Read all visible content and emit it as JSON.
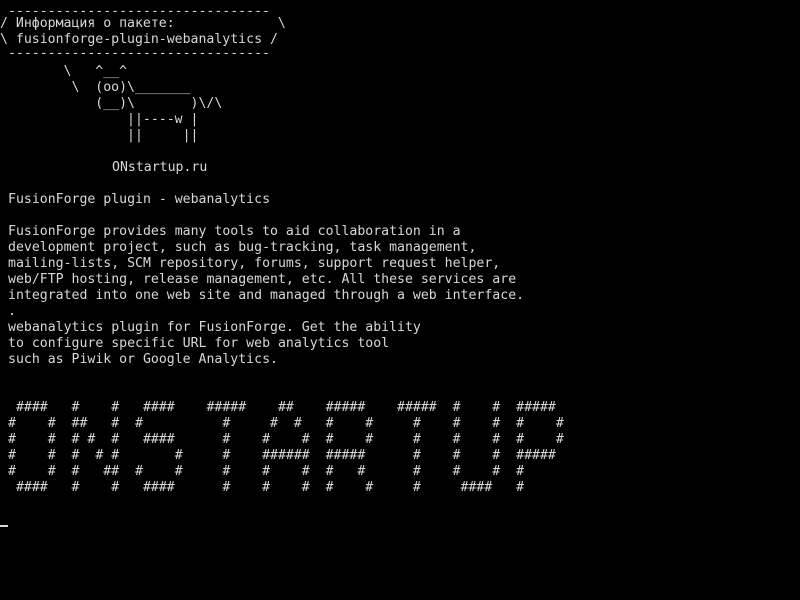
{
  "screen": {
    "background": "#000000",
    "foreground": "#d8d8d8"
  },
  "cowsay": {
    "top_border": " ---------------------------------",
    "title_line": "/ Информация о пакете:             \\",
    "package_line": "\\ fusionforge-plugin-webanalytics /",
    "bottom_border": " ---------------------------------",
    "cow": [
      "        \\   ^__^",
      "         \\  (oo)\\_______",
      "            (__)\\       )\\/\\",
      "                ||----w |",
      "                ||     ||"
    ]
  },
  "site": "ONstartup.ru",
  "package_title": "FusionForge plugin - webanalytics",
  "description": [
    "FusionForge provides many tools to aid collaboration in a",
    "development project, such as bug-tracking, task management,",
    "mailing-lists, SCM repository, forums, support request helper,",
    "web/FTP hosting, release management, etc. All these services are",
    "integrated into one web site and managed through a web interface.",
    ".",
    "webanalytics plugin for FusionForge. Get the ability",
    "to configure specific URL for web analytics tool",
    "such as Piwik or Google Analytics."
  ],
  "banner": [
    " ####   #    #   ####    #####    ##    #####    #####  #    #  #####",
    "#    #  ##   #  #          #     #  #   #    #     #    #    #  #    #",
    "#    #  # #  #   ####      #    #    #  #    #     #    #    #  #    #",
    "#    #  #  # #       #     #    ######  #####      #    #    #  #####",
    "#    #  #   ##  #    #     #    #    #  #   #      #    #    #  #",
    " ####   #    #   ####      #    #    #  #    #     #     ####   #"
  ]
}
